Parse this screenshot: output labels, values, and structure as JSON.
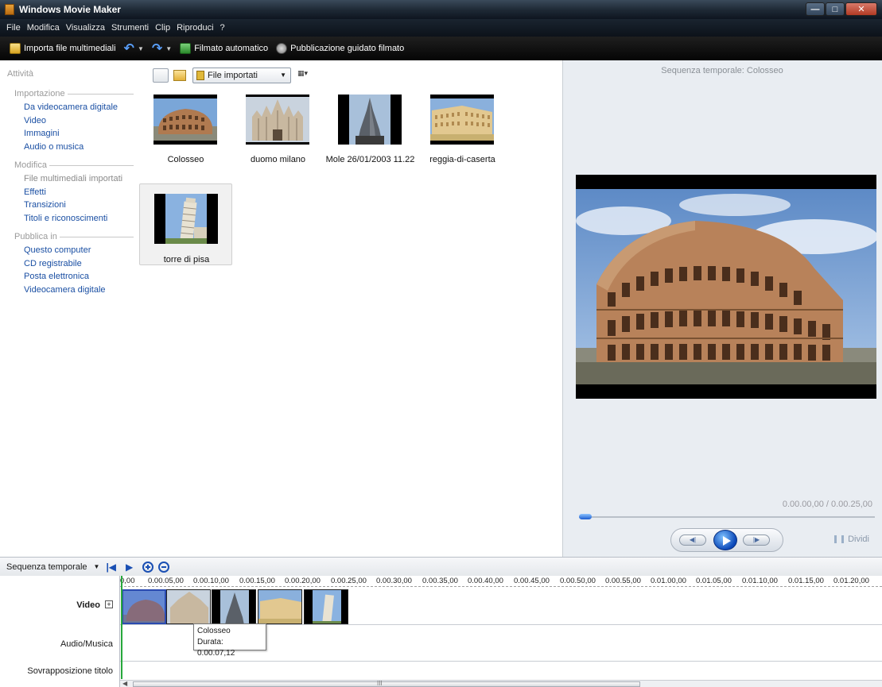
{
  "window": {
    "title": "Windows Movie Maker"
  },
  "menu": [
    "File",
    "Modifica",
    "Visualizza",
    "Strumenti",
    "Clip",
    "Riproduci",
    "?"
  ],
  "toolbar": {
    "import": "Importa file multimediali",
    "auto_movie": "Filmato automatico",
    "publish": "Pubblicazione guidato filmato"
  },
  "tasks": {
    "title": "Attività",
    "sections": [
      {
        "head": "Importazione",
        "items": [
          "Da videocamera digitale",
          "Video",
          "Immagini",
          "Audio o musica"
        ]
      },
      {
        "head": "Modifica",
        "items": [
          "File multimediali importati",
          "Effetti",
          "Transizioni",
          "Titoli e riconoscimenti"
        ]
      },
      {
        "head": "Pubblica in",
        "items": [
          "Questo computer",
          "CD registrabile",
          "Posta elettronica",
          "Videocamera digitale"
        ]
      }
    ]
  },
  "collection": {
    "selector": "File importati",
    "items": [
      {
        "label": "Colosseo",
        "icon": "colosseum-image"
      },
      {
        "label": "duomo milano",
        "icon": "duomo-image"
      },
      {
        "label": "Mole 26/01/2003 11.22",
        "icon": "mole-image"
      },
      {
        "label": "reggia-di-caserta",
        "icon": "reggia-image"
      },
      {
        "label": "torre di pisa",
        "icon": "pisa-image"
      }
    ]
  },
  "preview": {
    "title": "Sequenza temporale: Colosseo",
    "time": "0.00.00,00 / 0.00.25,00",
    "split": "Dividi",
    "position": 0
  },
  "timeline": {
    "label": "Sequenza temporale",
    "ruler": [
      "0,00",
      "0.00.05,00",
      "0.00.10,00",
      "0.00.15,00",
      "0.00.20,00",
      "0.00.25,00",
      "0.00.30,00",
      "0.00.35,00",
      "0.00.40,00",
      "0.00.45,00",
      "0.00.50,00",
      "0.00.55,00",
      "0.01.00,00",
      "0.01.05,00",
      "0.01.10,00",
      "0.01.15,00",
      "0.01.20,00"
    ],
    "rows": {
      "video": "Video",
      "audio": "Audio/Musica",
      "title": "Sovrapposizione titolo"
    },
    "tooltip": {
      "name": "Colosseo",
      "duration": "Durata: 0.00.07,12"
    },
    "scroll_label": "III"
  }
}
